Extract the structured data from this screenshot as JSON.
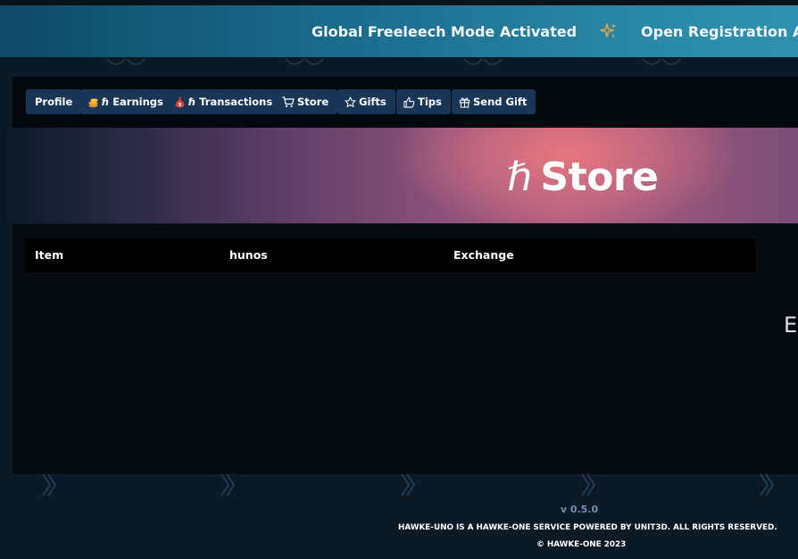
{
  "ticker": {
    "items": [
      "Global Freeleech Mode Activated",
      "Open Registration Activated"
    ],
    "separator_icon": "sparkles-icon"
  },
  "nav": {
    "buttons": [
      {
        "label": "Profile",
        "icon": ""
      },
      {
        "label": "ℏ Earnings",
        "icon": "coins-icon"
      },
      {
        "label": "ℏ Transactions",
        "icon": "money-bag-icon"
      },
      {
        "label": "Store",
        "icon": "cart-icon"
      },
      {
        "label": "Gifts",
        "icon": "star-icon"
      },
      {
        "label": "Tips",
        "icon": "thumbs-up-icon"
      },
      {
        "label": "Send Gift",
        "icon": "gift-icon"
      }
    ]
  },
  "hero": {
    "symbol": "ℏ",
    "title": "Store"
  },
  "table": {
    "columns": [
      "Item",
      "hunos",
      "Exchange"
    ],
    "rows": []
  },
  "edge_text": "E",
  "footer": {
    "version": "v 0.5.0",
    "line": "HAWKE-UNO IS A HAWKE-ONE SERVICE POWERED BY UNIT3D. ALL RIGHTS RESERVED.",
    "copyright": "© HAWKE-ONE 2023"
  },
  "colors": {
    "nav_button_bg": "#1a3656",
    "ticker_bg": "#1b6d8f",
    "hero_accent": "#e6767d",
    "version_text": "#6f8fb5"
  }
}
